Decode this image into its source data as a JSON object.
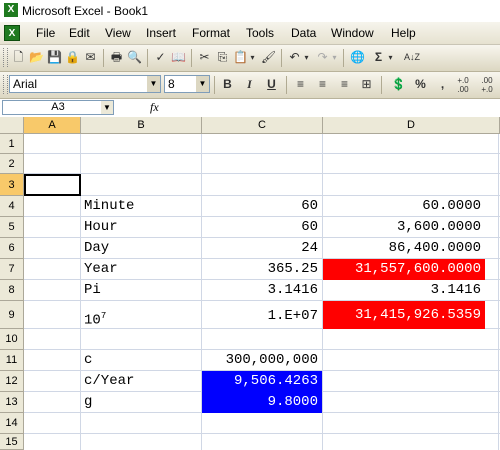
{
  "window": {
    "title": "Microsoft Excel - Book1"
  },
  "menu": [
    "File",
    "Edit",
    "View",
    "Insert",
    "Format",
    "Tools",
    "Data",
    "Window",
    "Help"
  ],
  "toolbar": {
    "font_name": "Arial",
    "font_size": "8",
    "bold_label": "B",
    "italic_label": "I",
    "underline_label": "U",
    "percent_label": "%",
    "comma_label": ",",
    "sum_label": "Σ",
    "sort_label": "A↓Z",
    "inc_decimal_label": "+.0 .00",
    "dec_decimal_label": ".00 +.0"
  },
  "formula_bar": {
    "name_box": "A3",
    "fx_label": "fx",
    "formula": ""
  },
  "columns": [
    "A",
    "B",
    "C",
    "D"
  ],
  "rows": [
    "1",
    "2",
    "3",
    "4",
    "5",
    "6",
    "7",
    "8",
    "9",
    "10",
    "11",
    "12",
    "13",
    "14",
    "15"
  ],
  "cells": {
    "B4": "Minute",
    "C4": "60",
    "D4": "60.0000",
    "B5": "Hour",
    "C5": "60",
    "D5": "3,600.0000",
    "B6": "Day",
    "C6": "24",
    "D6": "86,400.0000",
    "B7": "Year",
    "C7": "365.25",
    "D7": "31,557,600.0000",
    "B8": "Pi",
    "C8": "3.1416",
    "D8": "3.1416",
    "B9_base": "10",
    "B9_exp": "7",
    "C9": "1.E+07",
    "D9": "31,415,926.5359",
    "B11": "c",
    "C11": "300,000,000",
    "B12": "c/Year",
    "C12": "9,506.4263",
    "B13": "g",
    "C13": "9.8000"
  },
  "colors": {
    "red_fill": "#ff0000",
    "blue_fill": "#0000ff",
    "white_text": "#ffffff",
    "active_header": "#f8c96a"
  }
}
